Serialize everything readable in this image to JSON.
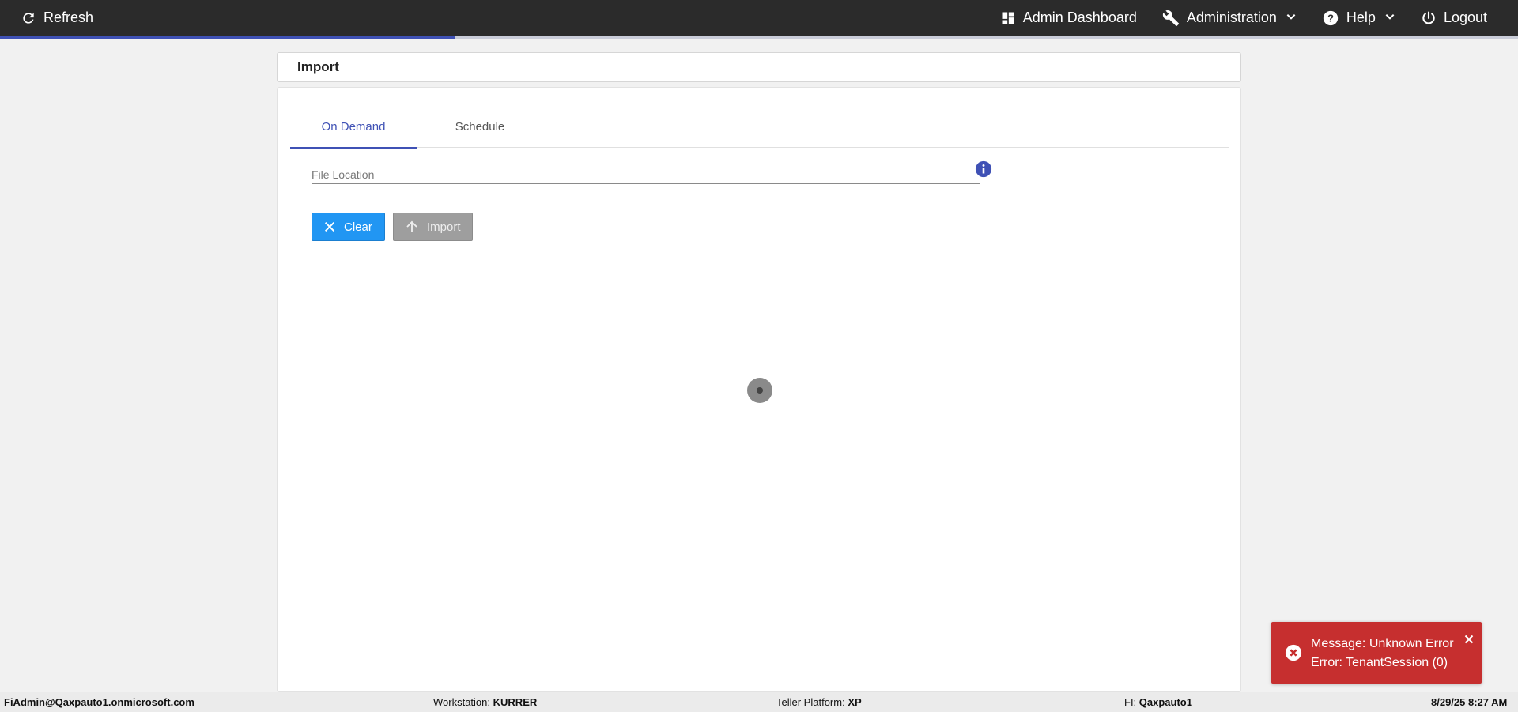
{
  "nav": {
    "refresh_label": "Refresh",
    "admin_dashboard_label": "Admin Dashboard",
    "administration_label": "Administration",
    "help_label": "Help",
    "logout_label": "Logout"
  },
  "page": {
    "title": "Import"
  },
  "tabs": [
    {
      "label": "On Demand",
      "active": true
    },
    {
      "label": "Schedule",
      "active": false
    }
  ],
  "form": {
    "file_location_placeholder": "File Location",
    "file_location_value": "",
    "clear_label": "Clear",
    "import_label": "Import"
  },
  "toast": {
    "line1": "Message: Unknown Error",
    "line2": "Error: TenantSession (0)"
  },
  "footer": {
    "user": "FiAdmin@Qaxpauto1.onmicrosoft.com",
    "workstation_label": "Workstation:",
    "workstation_value": "KURRER",
    "platform_label": "Teller Platform:",
    "platform_value": "XP",
    "fi_label": "FI:",
    "fi_value": "Qaxpauto1",
    "datetime": "8/29/25 8:27 AM"
  },
  "loading_progress": 0.3,
  "colors": {
    "navbar": "#2b2b2b",
    "accent": "#3f51b5",
    "clear_button": "#2196f3",
    "import_button_disabled": "#9e9e9e",
    "error_toast": "#c62f2f"
  },
  "icons": {
    "refresh": "refresh-icon",
    "dashboard": "dashboard-icon",
    "administration": "wrench-icon",
    "help": "help-circle-icon",
    "logout": "power-icon",
    "info": "info-icon",
    "clear": "close-icon",
    "import": "arrow-up-icon",
    "error": "error-circle-icon",
    "dismiss": "close-icon"
  }
}
